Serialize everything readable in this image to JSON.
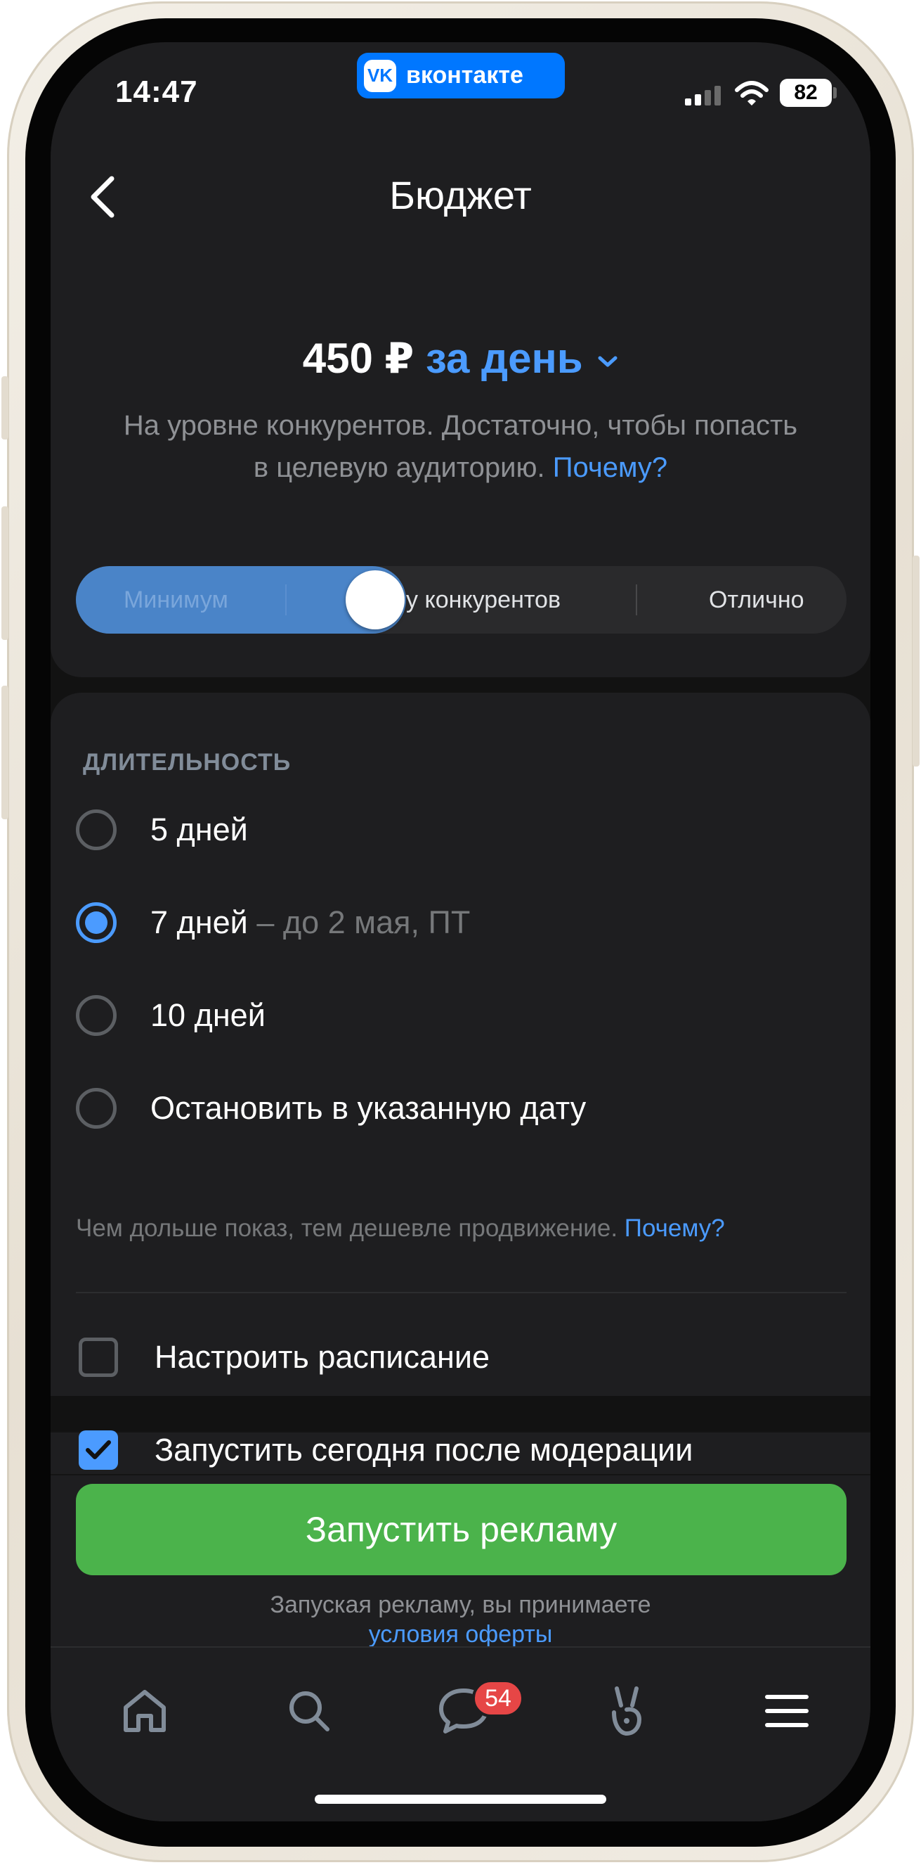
{
  "status_bar": {
    "time": "14:47",
    "app_badge": "вконтакте",
    "app_logo": "VK",
    "battery": "82",
    "icons": [
      "signal-icon",
      "wifi-icon",
      "battery-icon"
    ]
  },
  "header": {
    "title": "Бюджет",
    "back_icon": "chevron-left-icon"
  },
  "budget": {
    "amount": "450 ₽",
    "period": "за день",
    "period_icon": "chevron-down-icon",
    "description": "На уровне конкурентов. Достаточно, чтобы попасть в целевую аудиторию.",
    "why_link": "Почему?",
    "slider": {
      "options": [
        "Минимум",
        "На уровне конкурентов",
        "Отлично"
      ],
      "visible_middle_label": "у конкурентов",
      "selected_index": 1
    }
  },
  "duration": {
    "header": "ДЛИТЕЛЬНОСТЬ",
    "options": [
      {
        "label": "5 дней",
        "sub": "",
        "checked": false
      },
      {
        "label": "7 дней",
        "sub": " – до 2 мая, ПТ",
        "checked": true
      },
      {
        "label": "10 дней",
        "sub": "",
        "checked": false
      },
      {
        "label": "Остановить в указанную дату",
        "sub": "",
        "checked": false
      }
    ],
    "hint": "Чем дольше показ, тем дешевле продвижение.",
    "hint_link": "Почему?"
  },
  "options": {
    "schedule": {
      "label": "Настроить расписание",
      "checked": false
    },
    "launch_today": {
      "label": "Запустить сегодня после модерации",
      "checked": true
    }
  },
  "actions": {
    "launch_button": "Запустить рекламу",
    "terms_text": "Запуская рекламу, вы принимаете",
    "terms_link": "условия оферты"
  },
  "tab_bar": {
    "items": [
      "home-icon",
      "search-icon",
      "messages-icon",
      "clips-icon",
      "menu-icon"
    ],
    "messages_badge": "54"
  },
  "colors": {
    "accent": "#4b9bff",
    "vk_blue": "#0077ff",
    "launch_green": "#4bb34b",
    "badge_red": "#e64646",
    "card_background": "#1e1e20",
    "screen_background": "#121212"
  }
}
